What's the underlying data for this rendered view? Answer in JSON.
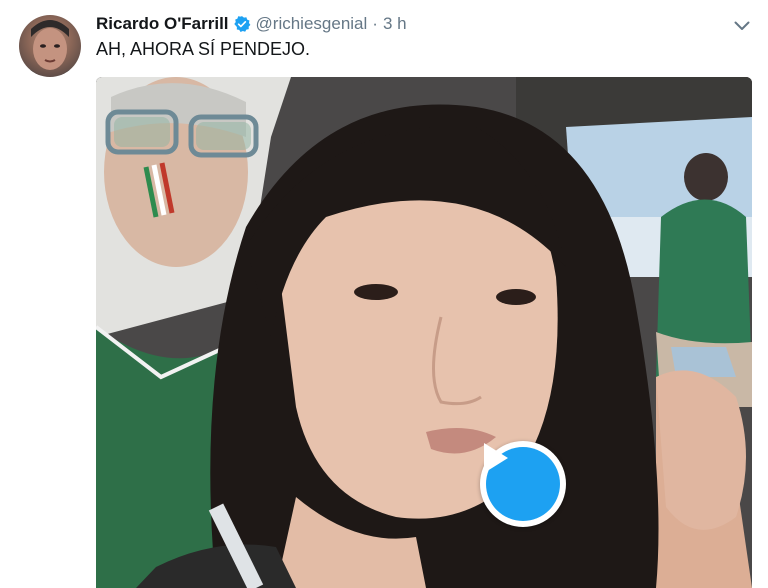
{
  "tweet": {
    "display_name": "Ricardo O'Farrill",
    "handle": "@richiesgenial",
    "separator": "·",
    "time": "3 h",
    "text": "AH, AHORA SÍ PENDEJO.",
    "verified": true
  },
  "icons": {
    "verified": "verified-badge-icon",
    "menu": "chevron-down-icon",
    "play": "play-icon"
  },
  "colors": {
    "accent": "#1da1f2",
    "name": "#14171a",
    "secondary": "#657786"
  }
}
